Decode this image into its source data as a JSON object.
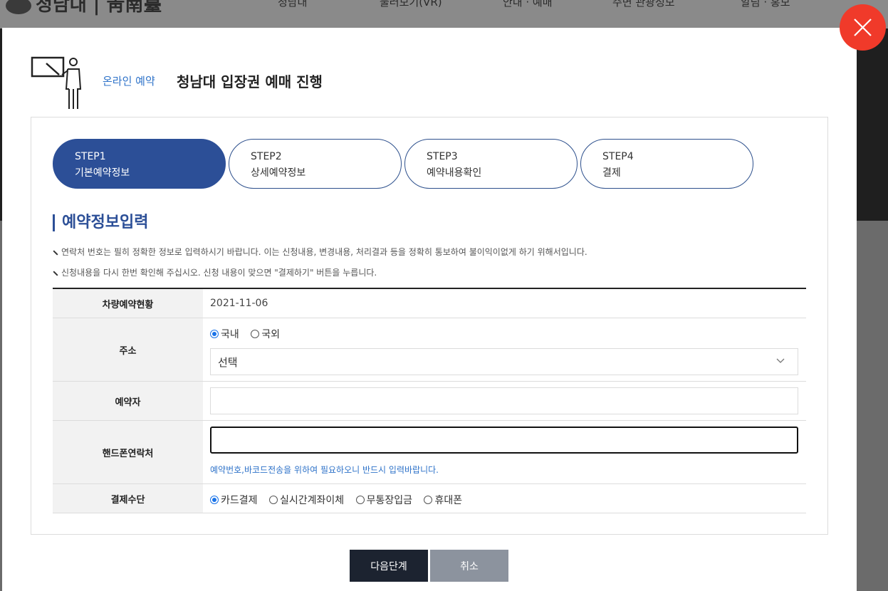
{
  "site": {
    "logo_text": "청남대 | 靑南臺",
    "nav": [
      "청남대",
      "둘러보기(VR)",
      "안내 · 예매",
      "주변 관광정보",
      "알림 · 홍보"
    ]
  },
  "modal": {
    "subtitle": "온라인 예약",
    "title": "청남대 입장권 예매 진행",
    "steps": [
      {
        "num": "STEP1",
        "label": "기본예약정보",
        "active": true
      },
      {
        "num": "STEP2",
        "label": "상세예약정보",
        "active": false
      },
      {
        "num": "STEP3",
        "label": "예약내용확인",
        "active": false
      },
      {
        "num": "STEP4",
        "label": "결제",
        "active": false
      }
    ],
    "section_title": "예약정보입력",
    "notes": [
      "연락처 번호는 필히 정확한 정보로 입력하시기 바랍니다. 이는 신청내용, 변경내용, 처리결과 등을 정확히 통보하여 불이익이없게 하기 위해서입니다.",
      "신청내용을 다시 한번 확인해 주십시오. 신청 내용이 맞으면 \"결제하기\" 버튼을 누릅니다."
    ],
    "form": {
      "vehicle": {
        "label": "차량예약현황",
        "value": "2021-11-06"
      },
      "address": {
        "label": "주소",
        "options": [
          "국내",
          "국외"
        ],
        "selected": "국내",
        "select_value": "선택"
      },
      "reserver": {
        "label": "예약자",
        "value": ""
      },
      "phone": {
        "label": "핸드폰연락처",
        "value": "",
        "help": "예약번호,바코드전송을 위하여 필요하오니 반드시 입력바랍니다."
      },
      "payment": {
        "label": "결제수단",
        "options": [
          "카드결제",
          "실시간계좌이체",
          "무통장입금",
          "휴대폰"
        ],
        "selected": "카드결제"
      }
    },
    "buttons": {
      "next": "다음단계",
      "cancel": "취소"
    }
  },
  "colors": {
    "primary": "#2c4f97",
    "link": "#2f73c9",
    "close": "#f03a2a",
    "dark_button": "#1c2330",
    "gray_button": "#8c939e"
  }
}
